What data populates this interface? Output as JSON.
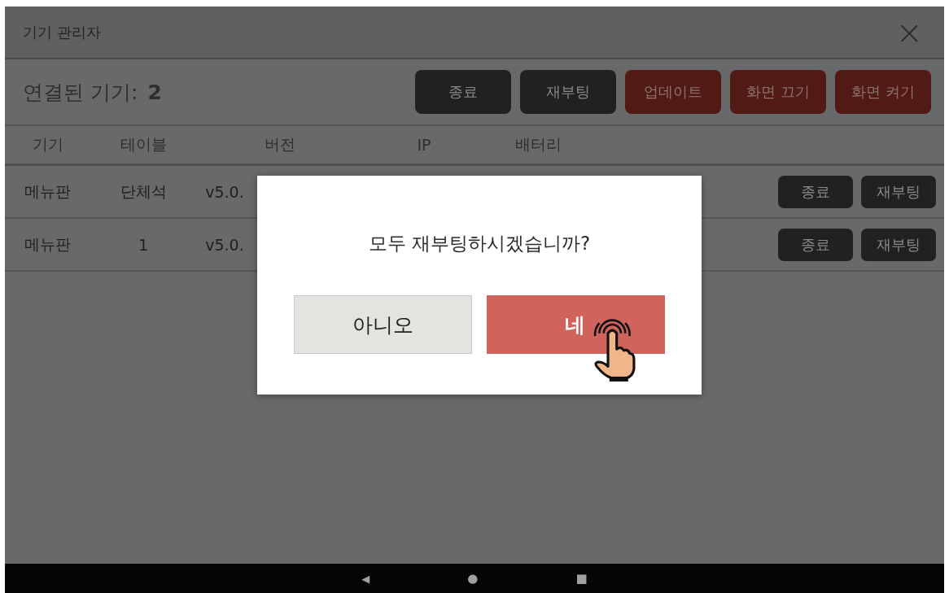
{
  "window": {
    "title": "기기 관리자",
    "close": "×"
  },
  "toolbar": {
    "connected_label": "연결된 기기:",
    "connected_count": "2",
    "buttons": [
      {
        "label": "종료",
        "kind": "dark"
      },
      {
        "label": "재부팅",
        "kind": "dark"
      },
      {
        "label": "업데이트",
        "kind": "red"
      },
      {
        "label": "화면 끄기",
        "kind": "red"
      },
      {
        "label": "화면 켜기",
        "kind": "red"
      }
    ]
  },
  "table": {
    "columns": [
      "기기",
      "테이블",
      "버전",
      "IP",
      "배터리"
    ],
    "rows": [
      {
        "device": "메뉴판",
        "table": "단체석",
        "version": "v5.0.",
        "buttons": [
          "종료",
          "재부팅"
        ]
      },
      {
        "device": "메뉴판",
        "table": "1",
        "version": "v5.0.",
        "buttons": [
          "종료",
          "재부팅"
        ]
      }
    ]
  },
  "dialog": {
    "message": "모두 재부팅하시겠습니까?",
    "cancel": "아니오",
    "confirm": "네"
  },
  "nav_bar": {
    "back": "◀",
    "home": "●",
    "recents": "■"
  }
}
